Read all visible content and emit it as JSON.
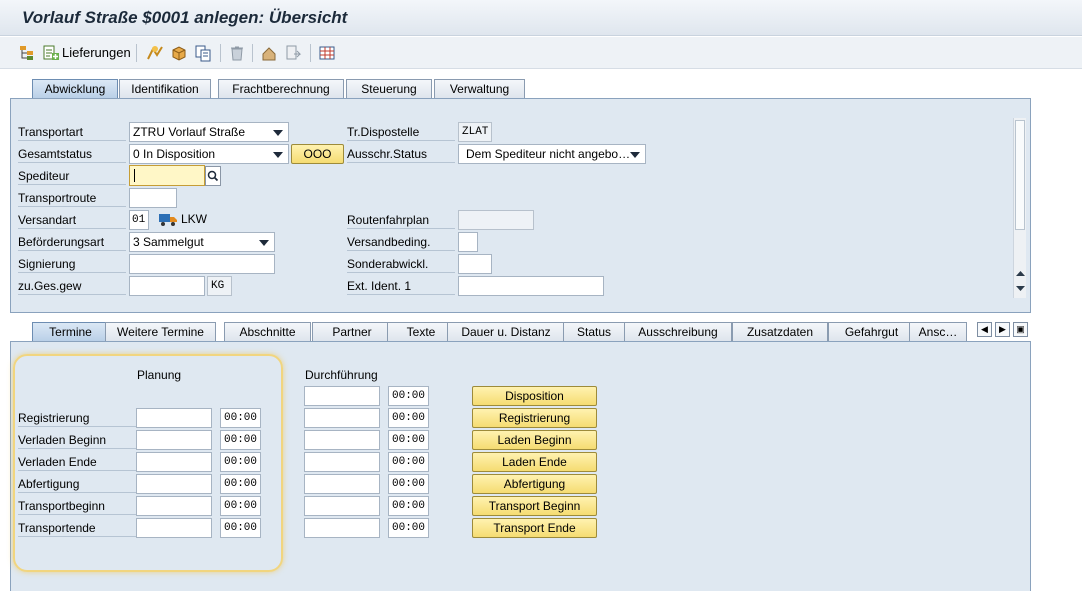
{
  "window": {
    "title": "Vorlauf Straße $0001 anlegen: Übersicht"
  },
  "toolbar": {
    "deliveries_label": "Lieferungen"
  },
  "header_tabs": [
    "Abwicklung",
    "Identifikation",
    "Frachtberechnung",
    "Steuerung",
    "Verwaltung"
  ],
  "header": {
    "transportart": {
      "label": "Transportart",
      "value": "ZTRU Vorlauf Straße"
    },
    "gesamtstatus": {
      "label": "Gesamtstatus",
      "value": "0 In Disposition"
    },
    "spediteur": {
      "label": "Spediteur",
      "value": ""
    },
    "transportroute": {
      "label": "Transportroute",
      "value": ""
    },
    "versandart": {
      "label": "Versandart",
      "value": "01",
      "text": "LKW"
    },
    "befoerderungsart": {
      "label": "Beförderungsart",
      "value": "3 Sammelgut"
    },
    "signierung": {
      "label": "Signierung",
      "value": ""
    },
    "zu_ges_gew": {
      "label": "zu.Ges.gew",
      "value": "",
      "unit": "KG"
    },
    "tr_dispostelle": {
      "label": "Tr.Dispostelle",
      "value": "ZLAT"
    },
    "ausschr_status": {
      "label": "Ausschr.Status",
      "value": "Dem Spediteur nicht angebo…"
    },
    "routenfahrplan": {
      "label": "Routenfahrplan",
      "value": ""
    },
    "versandbeding": {
      "label": "Versandbeding.",
      "value": ""
    },
    "sonderabwickl": {
      "label": "Sonderabwickl.",
      "value": ""
    },
    "ext_ident": {
      "label": "Ext. Ident. 1",
      "value": ""
    },
    "status_button_label": "OOO"
  },
  "detail_tabs": [
    "Termine",
    "Weitere Termine",
    "Abschnitte",
    "Partner",
    "Texte",
    "Dauer u. Distanz",
    "Status",
    "Ausschreibung",
    "Zusatzdaten",
    "Gefahrgut",
    "Ansc…"
  ],
  "termine": {
    "planung_header": "Planung",
    "durchfuehrung_header": "Durchführung",
    "rows": [
      {
        "label": "",
        "time_plan": "",
        "time_exec": "00:00",
        "button": "Disposition"
      },
      {
        "label": "Registrierung",
        "time_plan": "00:00",
        "time_exec": "00:00",
        "button": "Registrierung"
      },
      {
        "label": "Verladen Beginn",
        "time_plan": "00:00",
        "time_exec": "00:00",
        "button": "Laden Beginn"
      },
      {
        "label": "Verladen Ende",
        "time_plan": "00:00",
        "time_exec": "00:00",
        "button": "Laden Ende"
      },
      {
        "label": "Abfertigung",
        "time_plan": "00:00",
        "time_exec": "00:00",
        "button": "Abfertigung"
      },
      {
        "label": "Transportbeginn",
        "time_plan": "00:00",
        "time_exec": "00:00",
        "button": "Transport Beginn"
      },
      {
        "label": "Transportende",
        "time_plan": "00:00",
        "time_exec": "00:00",
        "button": "Transport Ende"
      }
    ]
  }
}
